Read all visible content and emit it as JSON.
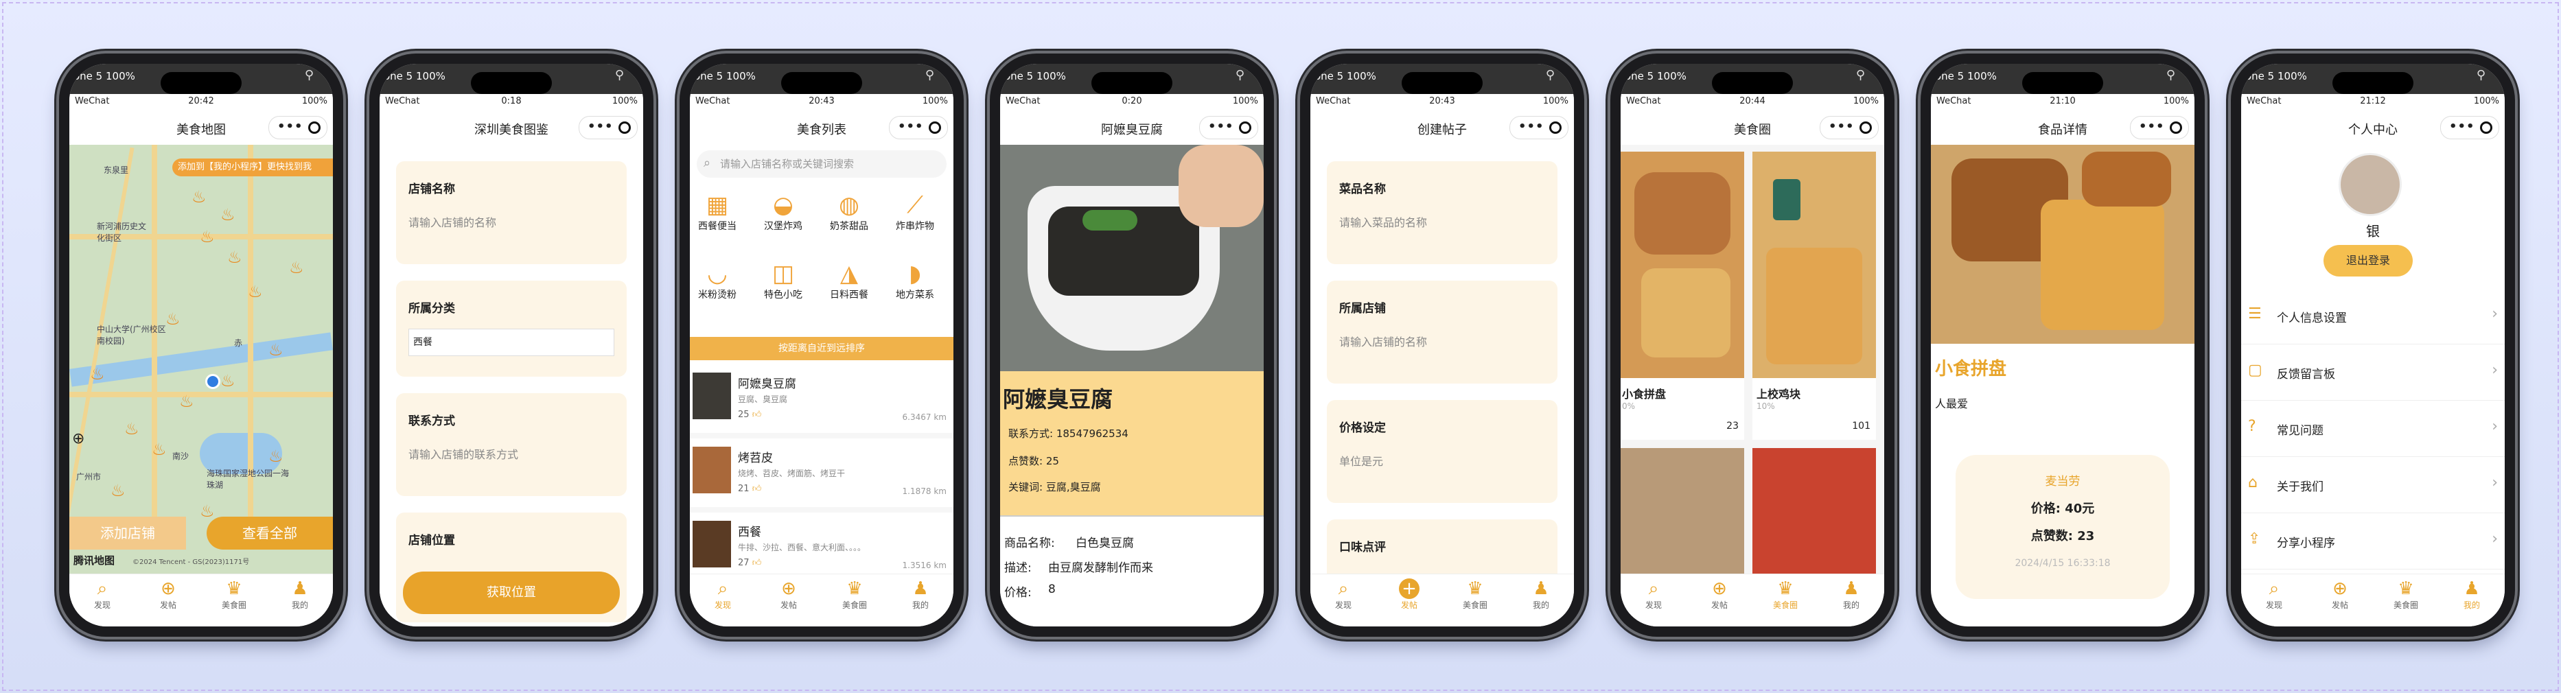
{
  "common": {
    "carrier_short": "one 5 100%",
    "wechat": "WeChat",
    "battery": "100%",
    "capsule_dots": "•••",
    "tabs": [
      "发现",
      "发帖",
      "美食圈",
      "我的"
    ]
  },
  "phones": [
    {
      "time": "20:42",
      "title": "美食地图"
    },
    {
      "time": "0:18",
      "title": "深圳美食图鉴"
    },
    {
      "time": "20:43",
      "title": "美食列表"
    },
    {
      "time": "0:20",
      "title": "阿嬷臭豆腐"
    },
    {
      "time": "20:43",
      "title": "创建帖子"
    },
    {
      "time": "20:44",
      "title": "美食圈"
    },
    {
      "time": "21:10",
      "title": "食品详情"
    },
    {
      "time": "21:12",
      "title": "个人中心"
    }
  ],
  "map": {
    "banner": "添加到【我的小程序】更快找到我",
    "labels": [
      "东泉里",
      "新河浦历史文化街区",
      "中山大学(广州校区南校园)",
      "海珠国家湿地公园一海珠湖",
      "广州市",
      "南沙",
      "赤"
    ],
    "add_button": "添加店铺",
    "view_all_button": "查看全部",
    "footer": "腾讯地图",
    "copyright": "©2024 Tencent - GS(2023)1171号"
  },
  "shop_form": {
    "fields": [
      {
        "label": "店铺名称",
        "placeholder": "请输入店铺的名称"
      },
      {
        "label": "所属分类",
        "value": "西餐"
      },
      {
        "label": "联系方式",
        "placeholder": "请输入店铺的联系方式"
      },
      {
        "label": "店铺位置"
      }
    ],
    "location_button": "获取位置"
  },
  "list": {
    "search_placeholder": "请输入店铺名称或关键词搜索",
    "categories": [
      "西餐便当",
      "汉堡炸鸡",
      "奶茶甜品",
      "炸串炸物",
      "米粉烫粉",
      "特色小吃",
      "日料西餐",
      "地方菜系"
    ],
    "sort_label": "按距离自近到远排序",
    "rows": [
      {
        "name": "阿嬷臭豆腐",
        "tags": "豆腐、臭豆腐",
        "likes": "25",
        "dist": "6.3467 km"
      },
      {
        "name": "烤苕皮",
        "tags": "烧烤、苕皮、烤面筋、烤豆干",
        "likes": "21",
        "dist": "1.1878 km"
      },
      {
        "name": "西餐",
        "tags": "牛排、沙拉、西餐、意大利面、。。。",
        "likes": "27",
        "dist": "1.3516 km"
      }
    ]
  },
  "detail": {
    "name": "阿嬷臭豆腐",
    "contact": "联系方式: 18547962534",
    "likes": "点赞数: 25",
    "keywords": "关键词: 豆腐,臭豆腐",
    "goods_name_label": "商品名称:",
    "goods_name": "白色臭豆腐",
    "desc_label": "描述:",
    "desc": "由豆腐发酵制作而来",
    "price_label": "价格:",
    "price": "8"
  },
  "post_form": {
    "fields": [
      {
        "label": "菜品名称",
        "placeholder": "请输入菜品的名称"
      },
      {
        "label": "所属店铺",
        "placeholder": "请输入店铺的名称"
      },
      {
        "label": "价格设定",
        "placeholder": "单位是元"
      },
      {
        "label": "口味点评"
      }
    ]
  },
  "circle": {
    "items": [
      {
        "name": "小食拼盘",
        "pct": "0%",
        "likes": "23"
      },
      {
        "name": "上校鸡块",
        "pct": "10%",
        "likes": "101"
      }
    ]
  },
  "food_detail": {
    "title": "小食拼盘",
    "sub": "人最爱",
    "author": "麦当劳",
    "price": "价格: 40元",
    "likes": "点赞数: 23",
    "date": "2024/4/15 16:33:18"
  },
  "profile": {
    "username": "银",
    "logout": "退出登录",
    "menu": [
      "个人信息设置",
      "反馈留言板",
      "常见问题",
      "关于我们",
      "分享小程序"
    ]
  },
  "colors": {
    "accent": "#e8a52c",
    "card": "#fdf5e6",
    "banner": "#f0a23a",
    "info": "#fbd990"
  },
  "icons": [
    "wifi-icon",
    "location-pin-icon",
    "search-icon",
    "thumb-up-icon",
    "chevron-right-icon",
    "plus-circle-icon",
    "chef-hat-icon",
    "user-icon"
  ]
}
